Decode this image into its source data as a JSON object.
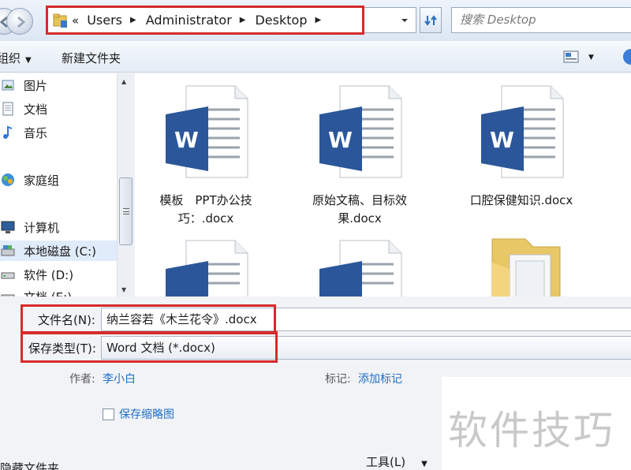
{
  "address_bar": {
    "overflow_chevron": "«",
    "crumbs": [
      "Users",
      "Administrator",
      "Desktop"
    ],
    "search_placeholder": "搜索 Desktop"
  },
  "toolbar": {
    "organize_label": "组织",
    "new_folder_label": "新建文件夹"
  },
  "nav_pane": {
    "items": [
      {
        "label": "图片",
        "icon": "pictures-icon"
      },
      {
        "label": "文档",
        "icon": "documents-icon"
      },
      {
        "label": "音乐",
        "icon": "music-icon"
      },
      {
        "label": "家庭组",
        "icon": "homegroup-icon"
      },
      {
        "label": "计算机",
        "icon": "computer-icon"
      },
      {
        "label": "本地磁盘 (C:)",
        "icon": "local-disk-icon",
        "selected": true
      },
      {
        "label": "软件 (D:)",
        "icon": "drive-icon"
      },
      {
        "label": "文档 (E:)",
        "icon": "drive-icon"
      }
    ]
  },
  "files": [
    {
      "label": "模板　PPT办公技\n巧：.docx",
      "icon": "word-doc-icon"
    },
    {
      "label": "原始文稿、目标效\n果.docx",
      "icon": "word-doc-icon"
    },
    {
      "label": "口腔保健知识.docx",
      "icon": "word-doc-icon"
    },
    {
      "label": "",
      "icon": "word-doc-icon"
    },
    {
      "label": "",
      "icon": "word-doc-icon"
    },
    {
      "label": "",
      "icon": "folder-icon"
    }
  ],
  "save_form": {
    "filename_label": "文件名(N):",
    "filename_value": "纳兰容若《木兰花令》.docx",
    "filetype_label": "保存类型(T):",
    "filetype_value": "Word 文档 (*.docx)",
    "author_label": "作者:",
    "author_value": "李小白",
    "tags_label": "标记:",
    "tags_value": "添加标记",
    "thumbnail_label": "保存缩略图",
    "hide_folders_label": "隐藏文件夹",
    "tools_label": "工具(L)"
  },
  "watermark_text": "软件技巧",
  "colors": {
    "highlight_red": "#d62b2b",
    "link_blue": "#1f6fc8",
    "word_blue": "#2b579a"
  }
}
